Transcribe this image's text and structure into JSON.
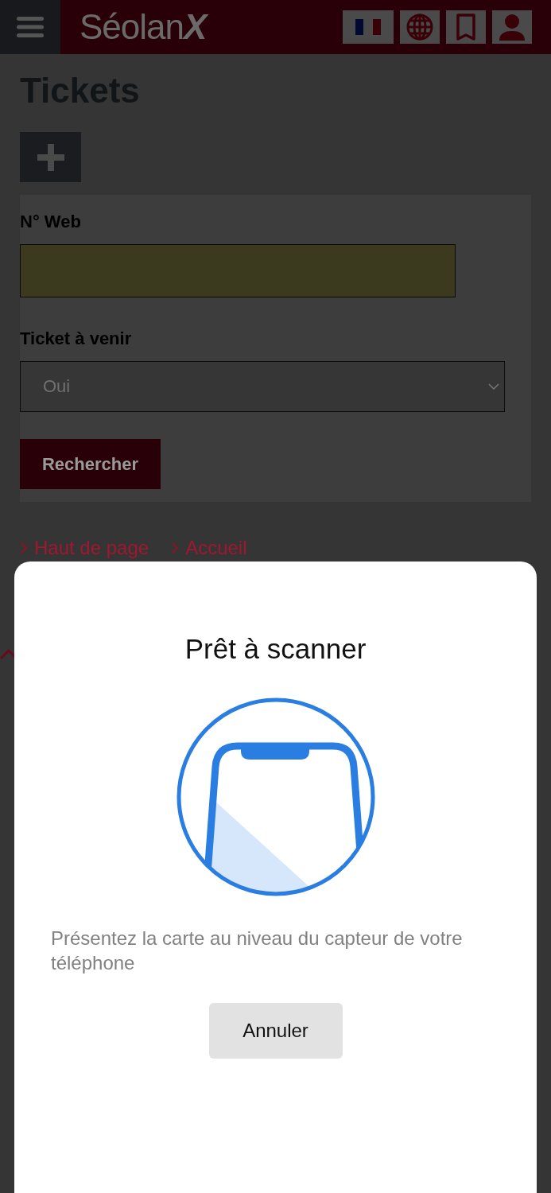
{
  "header": {
    "logo": "Séolan**X**"
  },
  "page": {
    "title": "Tickets",
    "search_form": {
      "fields": [
        {
          "kind": "text",
          "label": "N° Web"
        },
        {
          "kind": "select",
          "label": "Ticket à venir",
          "value": "Oui"
        }
      ],
      "submit": "Rechercher"
    },
    "footer_links": [
      "Haut de page",
      "Accueil"
    ]
  },
  "scan_sheet": {
    "title": "Prêt à scanner",
    "message": "Présentez la carte au niveau du capteur de votre téléphone",
    "cancel_button": "Annuler"
  }
}
